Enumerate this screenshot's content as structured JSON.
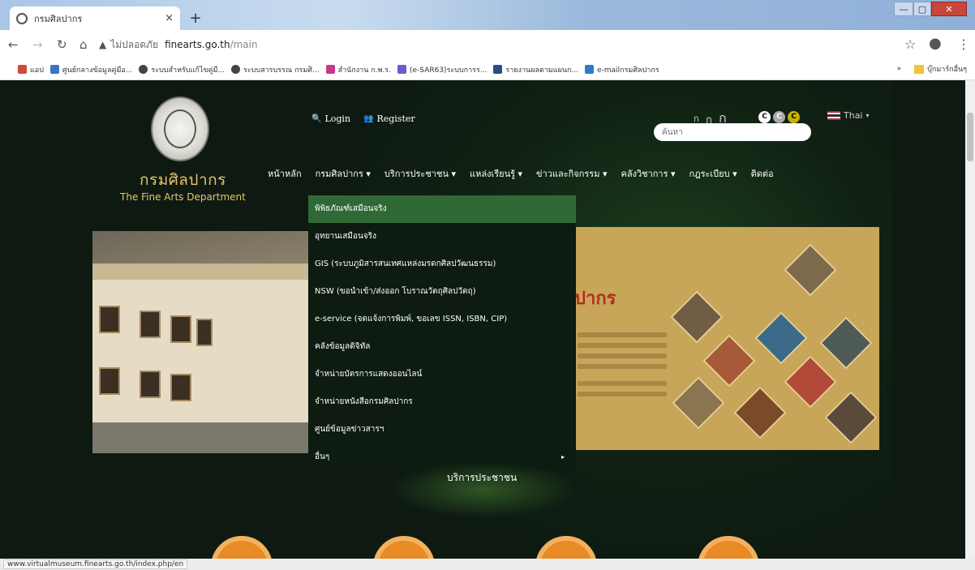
{
  "browser": {
    "tab_title": "กรมศิลปากร",
    "tab_close": "×",
    "new_tab": "+",
    "window_min": "—",
    "window_max": "▢",
    "window_close": "✕",
    "security_label": "ไม่ปลอดภัย",
    "security_icon": "▲",
    "url_host": "finearts.go.th",
    "url_path": "/main",
    "star_icon": "☆",
    "menu_icon": "⋮",
    "profile_icon": "●",
    "status_url": "www.virtualmuseum.finearts.go.th/index.php/en"
  },
  "bookmarks": [
    {
      "label": "แอป",
      "icon": "apps-icon",
      "color": "#d04a3a"
    },
    {
      "label": "ศูนย์กลางข้อมูลคู่มือ...",
      "icon": "bookmark-icon",
      "color": "#3b72c4"
    },
    {
      "label": "ระบบสำหรับแก้ไขคู่มื...",
      "icon": "globe-icon",
      "color": "#444444"
    },
    {
      "label": "ระบบสารบรรณ กรมศิ...",
      "icon": "globe-icon",
      "color": "#444444"
    },
    {
      "label": "สำนักงาน ก.พ.ร.",
      "icon": "bookmark-icon",
      "color": "#c33b8b"
    },
    {
      "label": "(e-SAR63)ระบบการร...",
      "icon": "bookmark-icon",
      "color": "#6a5bd1"
    },
    {
      "label": "รายงานผลตามแผนก...",
      "icon": "sheet-icon",
      "color": "#2c4a8a"
    },
    {
      "label": "e-mailกรมศิลปากร",
      "icon": "mail-icon",
      "color": "#3577c8"
    }
  ],
  "bookmarks_overflow": "»",
  "bookmarks_other": "บุ๊กมาร์กอื่นๆ",
  "site": {
    "brand_th": "กรมศิลปากร",
    "brand_en": "The Fine Arts Department",
    "login": "Login",
    "register": "Register",
    "font_small": "ก",
    "font_medium": "ก",
    "font_large": "ก",
    "contrast_labels": [
      "C",
      "C",
      "C"
    ],
    "language": "Thai",
    "search_placeholder": "ค้นหา",
    "menu": [
      "หน้าหลัก",
      "กรมศิลปากร ▾",
      "บริการประชาชน ▾",
      "แหล่งเรียนรู้ ▾",
      "ข่าวและกิจกรรม ▾",
      "คลังวิชาการ ▾",
      "กฎระเบียบ ▾",
      "ติดต่อ"
    ],
    "dropdown": [
      "พิพิธภัณฑ์เสมือนจริง",
      "อุทยานเสมือนจริง",
      "GIS (ระบบภูมิสารสนเทศแหล่งมรดกศิลปวัฒนธรรม)",
      "NSW (ขอนำเข้า/ส่งออก โบราณวัตถุศิลปวัตถุ)",
      "e-service (จดแจ้งการพิมพ์, ขอเลข ISSN, ISBN, CIP)",
      "คลังข้อมูลดิจิทัล",
      "จำหน่ายบัตรการแสดงออนไลน์",
      "จำหน่ายหนังสือกรมศิลปากร",
      "ศูนย์ข้อมูลข่าวสารฯ",
      "อื่นๆ"
    ],
    "dropdown_submenu_arrow": "▸",
    "service_label": "บริการประชาชน",
    "banner_heading": "ปากร"
  },
  "colors": {
    "page_bg": "#0e1a11",
    "brand_gold": "#e8c56a",
    "active_green": "#2f6a36",
    "accent_orange": "#e88a25"
  }
}
